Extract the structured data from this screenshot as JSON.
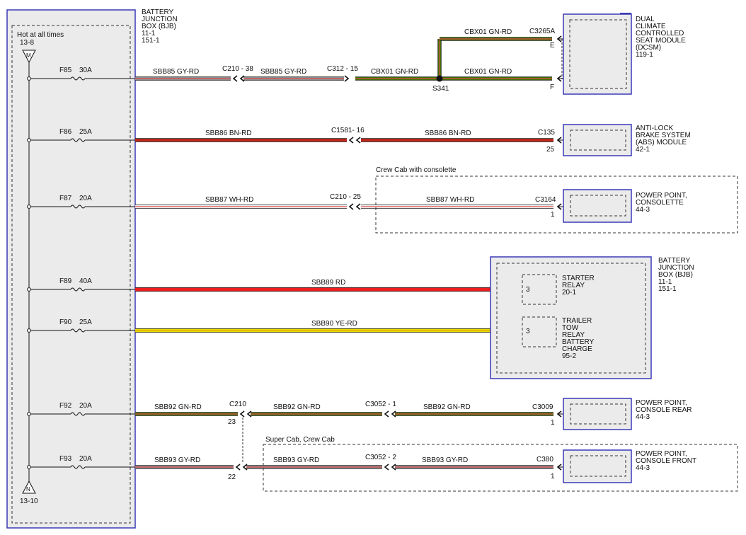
{
  "colors": {
    "box_fill": "#ebebeb",
    "box_border": "#3a3ab8",
    "dash": "#333333",
    "gy_rd_main": "#8c8c8c",
    "gy_rd_stripe": "#e05050",
    "bn_rd_main": "#a01c14",
    "bn_rd_stripe": "#e03020",
    "wh_rd_main": "#f2f2f2",
    "wh_rd_stripe": "#e05050",
    "rd": "#ee1c1c",
    "ye_rd_main": "#e6d800",
    "gn_rd_main": "#3c6e00",
    "gn_rd_stripe": "#e05050"
  },
  "bjb_left": {
    "title_lines": [
      "BATTERY",
      "JUNCTION",
      "BOX (BJB)",
      "11-1",
      "151-1"
    ],
    "hot_label": "Hot at all times",
    "hot_ref": "13-8",
    "top_symbol": "M",
    "bottom_symbol": "N",
    "bottom_ref": "13-10",
    "fuses": [
      {
        "name": "F85",
        "rating": "30A"
      },
      {
        "name": "F86",
        "rating": "25A"
      },
      {
        "name": "F87",
        "rating": "20A"
      },
      {
        "name": "F89",
        "rating": "40A"
      },
      {
        "name": "F90",
        "rating": "25A"
      },
      {
        "name": "F92",
        "rating": "20A"
      },
      {
        "name": "F93",
        "rating": "20A"
      }
    ]
  },
  "wires": {
    "f85_a": "SBB85   GY-RD",
    "f85_c1": "C210 - 38",
    "f85_b": "SBB85   GY-RD",
    "f85_c2": "C312 - 15",
    "f85_c": "CBX01   GN-RD",
    "splice": "S341",
    "cbx_top": "CBX01   GN-RD",
    "cbx_bottom": "CBX01   GN-RD",
    "f86_a": "SBB86   BN-RD",
    "f86_c1": "C1581- 16",
    "f86_b": "SBB86   BN-RD",
    "f87_a": "SBB87   WH-RD",
    "f87_c1": "C210 - 25",
    "f87_b": "SBB87   WH-RD",
    "f89": "SBB89   RD",
    "f90": "SBB90   YE-RD",
    "f92_a": "SBB92   GN-RD",
    "f92_c1": "C210",
    "f92_pin": "23",
    "f92_b": "SBB92   GN-RD",
    "f92_c2": "C3052 - 1",
    "f92_c": "SBB92   GN-RD",
    "f93_a": "SBB93   GY-RD",
    "f93_pin": "22",
    "f93_b": "SBB93   GY-RD",
    "f93_c2": "C3052 - 2",
    "f93_c": "SBB93   GY-RD"
  },
  "dcsm": {
    "connector": "C3265A",
    "pin_e": "E",
    "pin_f": "F",
    "title_lines": [
      "DUAL",
      "CLIMATE",
      "CONTROLLED",
      "SEAT MODULE",
      "(DCSM)",
      "119-1"
    ]
  },
  "abs": {
    "connector": "C135",
    "pin": "25",
    "title_lines": [
      "ANTI-LOCK",
      "BRAKE SYSTEM",
      "(ABS) MODULE",
      "42-1"
    ]
  },
  "consolette": {
    "option_label": "Crew Cab with consolette",
    "connector": "C3164",
    "pin": "1",
    "title_lines": [
      "POWER POINT,",
      "CONSOLETTE",
      "44-3"
    ]
  },
  "bjb_right": {
    "title_lines": [
      "BATTERY",
      "JUNCTION",
      "BOX (BJB)",
      "11-1",
      "151-1"
    ],
    "starter_pin": "3",
    "starter_lines": [
      "STARTER",
      "RELAY",
      "20-1"
    ],
    "trailer_pin": "3",
    "trailer_lines": [
      "TRAILER",
      "TOW",
      "RELAY",
      "BATTERY",
      "CHARGE",
      "95-2"
    ]
  },
  "console_rear": {
    "connector": "C3009",
    "pin": "1",
    "title_lines": [
      "POWER POINT,",
      "CONSOLE REAR",
      "44-3"
    ]
  },
  "console_front": {
    "option_label": "Super Cab, Crew Cab",
    "connector": "C380",
    "pin": "1",
    "title_lines": [
      "POWER POINT,",
      "CONSOLE FRONT",
      "44-3"
    ]
  }
}
